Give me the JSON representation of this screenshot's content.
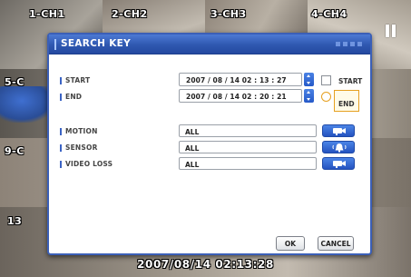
{
  "channels": [
    {
      "label": "1-CH1"
    },
    {
      "label": "2-CH2"
    },
    {
      "label": "3-CH3"
    },
    {
      "label": "4-CH4"
    },
    {
      "label": "5-C"
    },
    {
      "label": "9-C"
    },
    {
      "label": "13"
    }
  ],
  "osd": {
    "timestamp": "2007/08/14  02:13:28",
    "status_icon": "pause-icon"
  },
  "dialog": {
    "title": "SEARCH KEY",
    "start": {
      "label": "START",
      "value": "2007 / 08 / 14   02 : 13 : 27",
      "option_label": "START",
      "checked": false
    },
    "end": {
      "label": "END",
      "value": "2007 / 08 / 14   02 : 20 : 21",
      "option_label": "END",
      "selected": true
    },
    "filters": [
      {
        "label": "MOTION",
        "value": "ALL",
        "icon": "camera-icon"
      },
      {
        "label": "SENSOR",
        "value": "ALL",
        "icon": "alarm-bell-icon"
      },
      {
        "label": "VIDEO LOSS",
        "value": "ALL",
        "icon": "camera-icon"
      }
    ],
    "ok_label": "OK",
    "cancel_label": "CANCEL"
  },
  "colors": {
    "header_blue": "#2f58b0",
    "accent_blue": "#3b63c4",
    "highlight_orange": "#e6a020"
  }
}
